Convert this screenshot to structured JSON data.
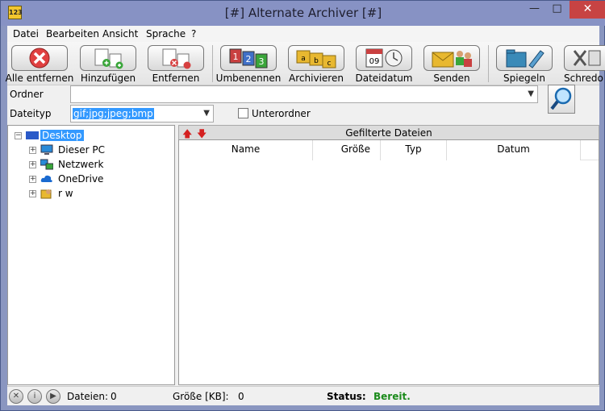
{
  "window": {
    "title": "[#] Alternate Archiver [#]",
    "app_icon_text": "123",
    "minimize": "—",
    "maximize": "□",
    "close": "✕"
  },
  "menu": [
    "Datei",
    "Bearbeiten",
    "Ansicht",
    "Sprache",
    "?"
  ],
  "toolbar": {
    "remove_all": "Alle entfernen",
    "add": "Hinzufügen",
    "remove": "Entfernen",
    "rename": "Umbenennen",
    "archive": "Archivieren",
    "file_date": "Dateidatum",
    "send": "Senden",
    "mirror": "Spiegeln",
    "shred": "Schredo"
  },
  "folder": {
    "label": "Ordner",
    "value": ""
  },
  "filetype": {
    "label": "Dateityp",
    "value": "gif;jpg;jpeg;bmp"
  },
  "subfolder": {
    "label": "Unterordner",
    "checked": false
  },
  "tree": {
    "root": "Desktop",
    "items": [
      "Dieser PC",
      "Netzwerk",
      "OneDrive",
      "r w"
    ]
  },
  "list": {
    "title": "Gefilterte Dateien",
    "columns": [
      "Name",
      "Größe",
      "Typ",
      "Datum"
    ]
  },
  "status": {
    "files_label": "Dateien:",
    "files_value": "0",
    "size_label": "Größe [KB]:",
    "size_value": "0",
    "status_label": "Status:",
    "status_value": "Bereit.",
    "status_color": "#1a8a1a"
  },
  "icons": [
    "stop-icon",
    "info-icon",
    "play-icon"
  ]
}
